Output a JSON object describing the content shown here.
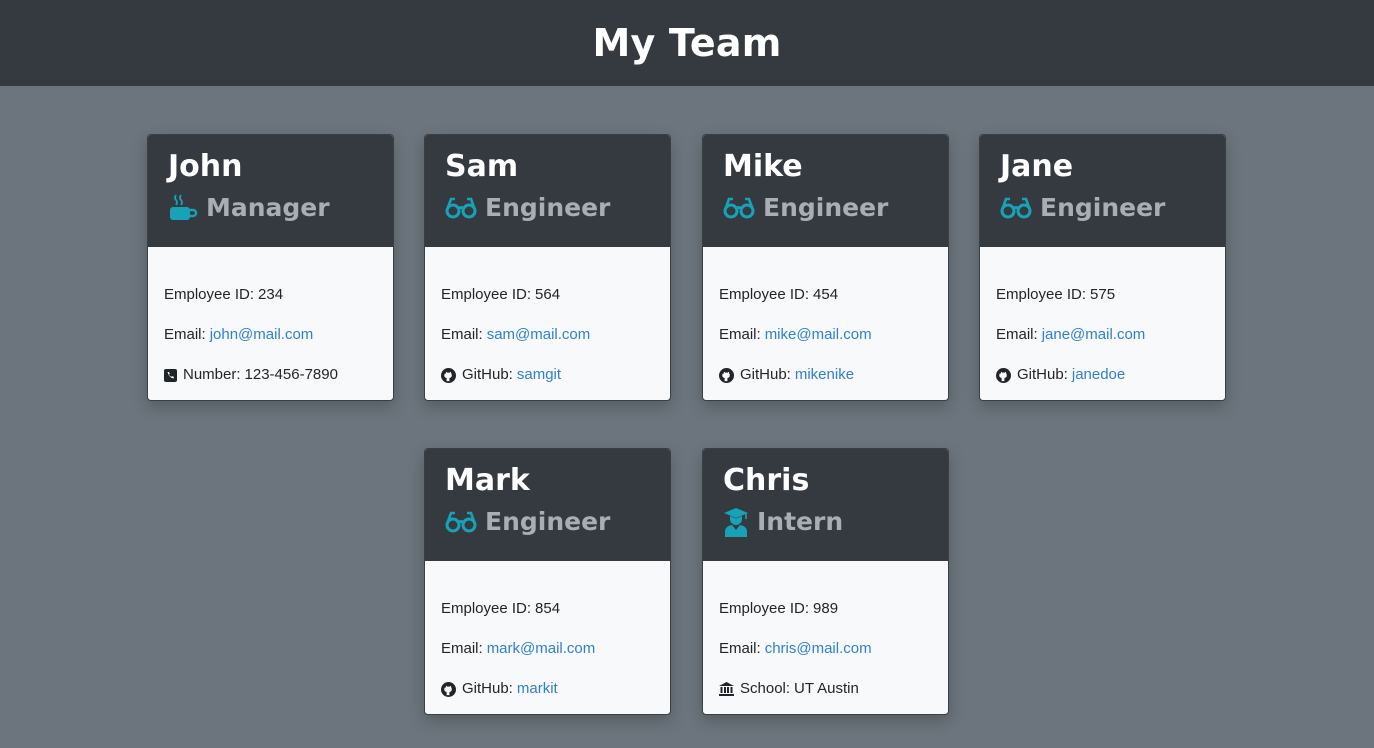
{
  "header": {
    "title": "My Team"
  },
  "colors": {
    "accent": "#17a2b8",
    "header_bg": "#343a40",
    "page_bg": "#6c757d",
    "link": "#2f7fd1"
  },
  "employees": [
    {
      "name": "John",
      "role": "Manager",
      "role_icon": "coffee-icon",
      "id_label": "Employee ID:",
      "id": "234",
      "email_label": "Email:",
      "email": "john@mail.com",
      "extra_icon": "phone-icon",
      "extra_label": "Number:",
      "extra_value": "123-456-7890"
    },
    {
      "name": "Sam",
      "role": "Engineer",
      "role_icon": "glasses-icon",
      "id_label": "Employee ID:",
      "id": "564",
      "email_label": "Email:",
      "email": "sam@mail.com",
      "extra_icon": "github-icon",
      "extra_label": "GitHub:",
      "extra_value": "samgit"
    },
    {
      "name": "Mike",
      "role": "Engineer",
      "role_icon": "glasses-icon",
      "id_label": "Employee ID:",
      "id": "454",
      "email_label": "Email:",
      "email": "mike@mail.com",
      "extra_icon": "github-icon",
      "extra_label": "GitHub:",
      "extra_value": "mikenike"
    },
    {
      "name": "Jane",
      "role": "Engineer",
      "role_icon": "glasses-icon",
      "id_label": "Employee ID:",
      "id": "575",
      "email_label": "Email:",
      "email": "jane@mail.com",
      "extra_icon": "github-icon",
      "extra_label": "GitHub:",
      "extra_value": "janedoe"
    },
    {
      "name": "Mark",
      "role": "Engineer",
      "role_icon": "glasses-icon",
      "id_label": "Employee ID:",
      "id": "854",
      "email_label": "Email:",
      "email": "mark@mail.com",
      "extra_icon": "github-icon",
      "extra_label": "GitHub:",
      "extra_value": "markit"
    },
    {
      "name": "Chris",
      "role": "Intern",
      "role_icon": "graduate-icon",
      "id_label": "Employee ID:",
      "id": "989",
      "email_label": "Email:",
      "email": "chris@mail.com",
      "extra_icon": "school-icon",
      "extra_label": "School:",
      "extra_value": "UT Austin"
    }
  ]
}
